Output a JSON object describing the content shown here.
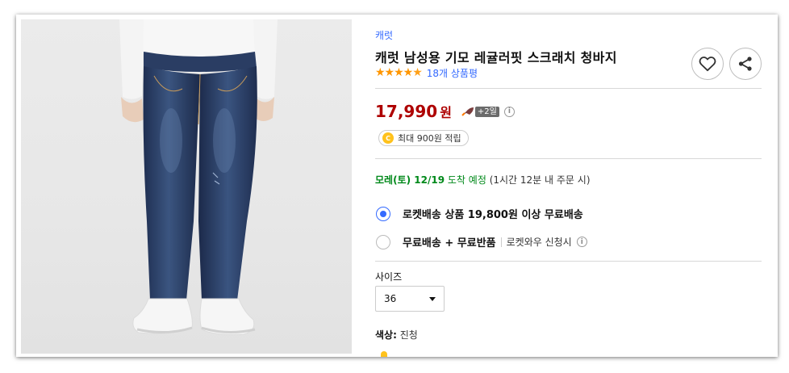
{
  "product": {
    "brand": "캐럿",
    "title": "캐럿 남성용 기모 레귤러핏 스크래치 청바지",
    "rating_stars": 4.5,
    "review_count": "18개 상품평",
    "image_alt": "청바지 착용 모델"
  },
  "actions": {
    "wishlist_icon": "heart-icon",
    "share_icon": "share-icon"
  },
  "price": {
    "amount": "17,990",
    "unit": "원",
    "rocket_badge": "+2일",
    "info": "i"
  },
  "reward": {
    "coin": "C",
    "text": "최대 900원 적립"
  },
  "arrival": {
    "date": "모레(토) 12/19",
    "word": "도착 예정",
    "detail": "(1시간 12분 내 주문 시)"
  },
  "delivery_options": [
    {
      "label": "로켓배송 상품 19,800원 이상 무료배송",
      "selected": true
    },
    {
      "label": "무료배송 + 무료반품",
      "sub": "로켓와우 신청시",
      "selected": false
    }
  ],
  "size": {
    "label": "사이즈",
    "selected": "36"
  },
  "color": {
    "label": "색상:",
    "value": "진청"
  },
  "colors": {
    "price_red": "#ae0000",
    "link_blue": "#346aff",
    "arrival_green": "#00891a",
    "star_orange": "#ff9600"
  }
}
